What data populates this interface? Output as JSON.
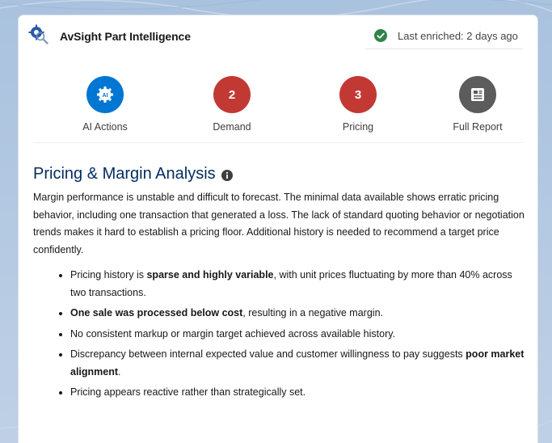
{
  "header": {
    "app_title": "AvSight Part Intelligence",
    "enriched_text": "Last enriched: 2 days ago",
    "icon": "gear-search-icon",
    "status_icon": "check-circle-icon",
    "status_color": "#2e844a"
  },
  "actions": [
    {
      "label": "AI Actions",
      "badge": "",
      "icon": "ai-gear-icon",
      "color": "#0176d3"
    },
    {
      "label": "Demand",
      "badge": "2",
      "icon": "",
      "color": "#c23934"
    },
    {
      "label": "Pricing",
      "badge": "3",
      "icon": "",
      "color": "#c23934"
    },
    {
      "label": "Full Report",
      "badge": "",
      "icon": "report-icon",
      "color": "#5c5c5c"
    }
  ],
  "section": {
    "title": "Pricing & Margin Analysis",
    "info_icon": "info-icon",
    "intro": "Margin performance is unstable and difficult to forecast. The minimal data available shows erratic pricing behavior, including one transaction that generated a loss. The lack of standard quoting behavior or negotiation trends makes it hard to establish a pricing floor. Additional history is needed to recommend a target price confidently.",
    "bullets": [
      {
        "pre": "Pricing history is ",
        "bold": "sparse and highly variable",
        "post": ", with unit prices fluctuating by more than 40% across two transactions."
      },
      {
        "pre": "",
        "bold": "One sale was processed below cost",
        "post": ", resulting in a negative margin."
      },
      {
        "pre": "No consistent markup or margin target achieved across available history.",
        "bold": "",
        "post": ""
      },
      {
        "pre": "Discrepancy between internal expected value and customer willingness to pay suggests ",
        "bold": "poor market alignment",
        "post": "."
      },
      {
        "pre": "Pricing appears reactive rather than strategically set.",
        "bold": "",
        "post": ""
      }
    ]
  }
}
